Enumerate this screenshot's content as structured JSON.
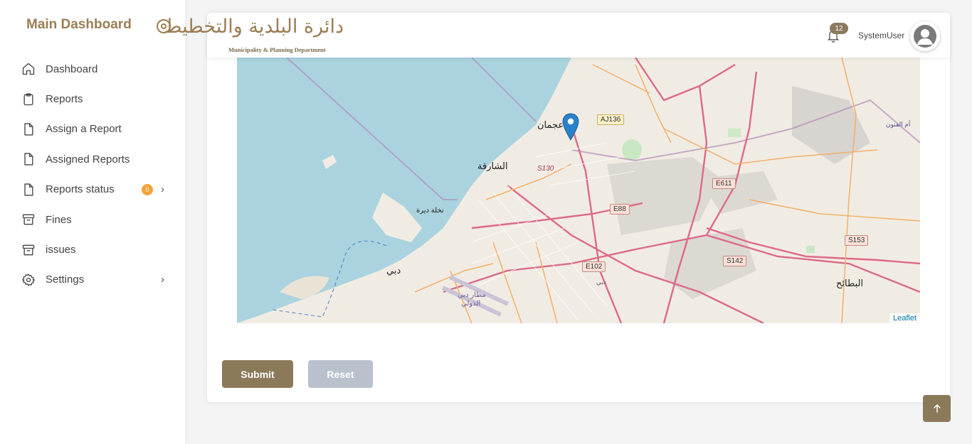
{
  "sidebar": {
    "title": "Main Dashboard",
    "items": [
      {
        "label": "Dashboard",
        "icon": "home-icon"
      },
      {
        "label": "Reports",
        "icon": "clipboard-icon"
      },
      {
        "label": "Assign a Report",
        "icon": "file-icon"
      },
      {
        "label": "Assigned Reports",
        "icon": "file-icon"
      },
      {
        "label": "Reports status",
        "icon": "file-icon",
        "badge": "0",
        "chevron": "›"
      },
      {
        "label": "Fines",
        "icon": "archive-icon"
      },
      {
        "label": "issues",
        "icon": "archive-icon"
      },
      {
        "label": "Settings",
        "icon": "gear-icon",
        "chevron": "›"
      }
    ]
  },
  "header": {
    "logo_arabic": "دائرة البلدية والتخطيط",
    "logo_english": "Municipality & Planning Department",
    "notification_count": "12",
    "username": "SystemUser"
  },
  "map": {
    "labels": {
      "ajman": "عجمان",
      "sharjah": "الشارقة",
      "deira_island": "نخلة ديرة",
      "dubai": "دبي",
      "airport_1": "مطار دبي",
      "airport_2": "الدولي",
      "dubai_small": "دبي",
      "bataeh": "البطائح",
      "umm_fannan": "أم الفنون"
    },
    "shields": {
      "aj136": "AJ136",
      "e611": "E611",
      "e88": "E88",
      "e102": "E102",
      "s142": "S142",
      "s153": "S153",
      "s130": "S130"
    },
    "attribution": "Leaflet"
  },
  "actions": {
    "submit": "Submit",
    "reset": "Reset"
  },
  "colors": {
    "accent": "#8b7a5a",
    "brand_text": "#9a7e54",
    "reset_bg": "#b8c1cc",
    "badge": "#f7a23b",
    "marker": "#2a81cb"
  }
}
